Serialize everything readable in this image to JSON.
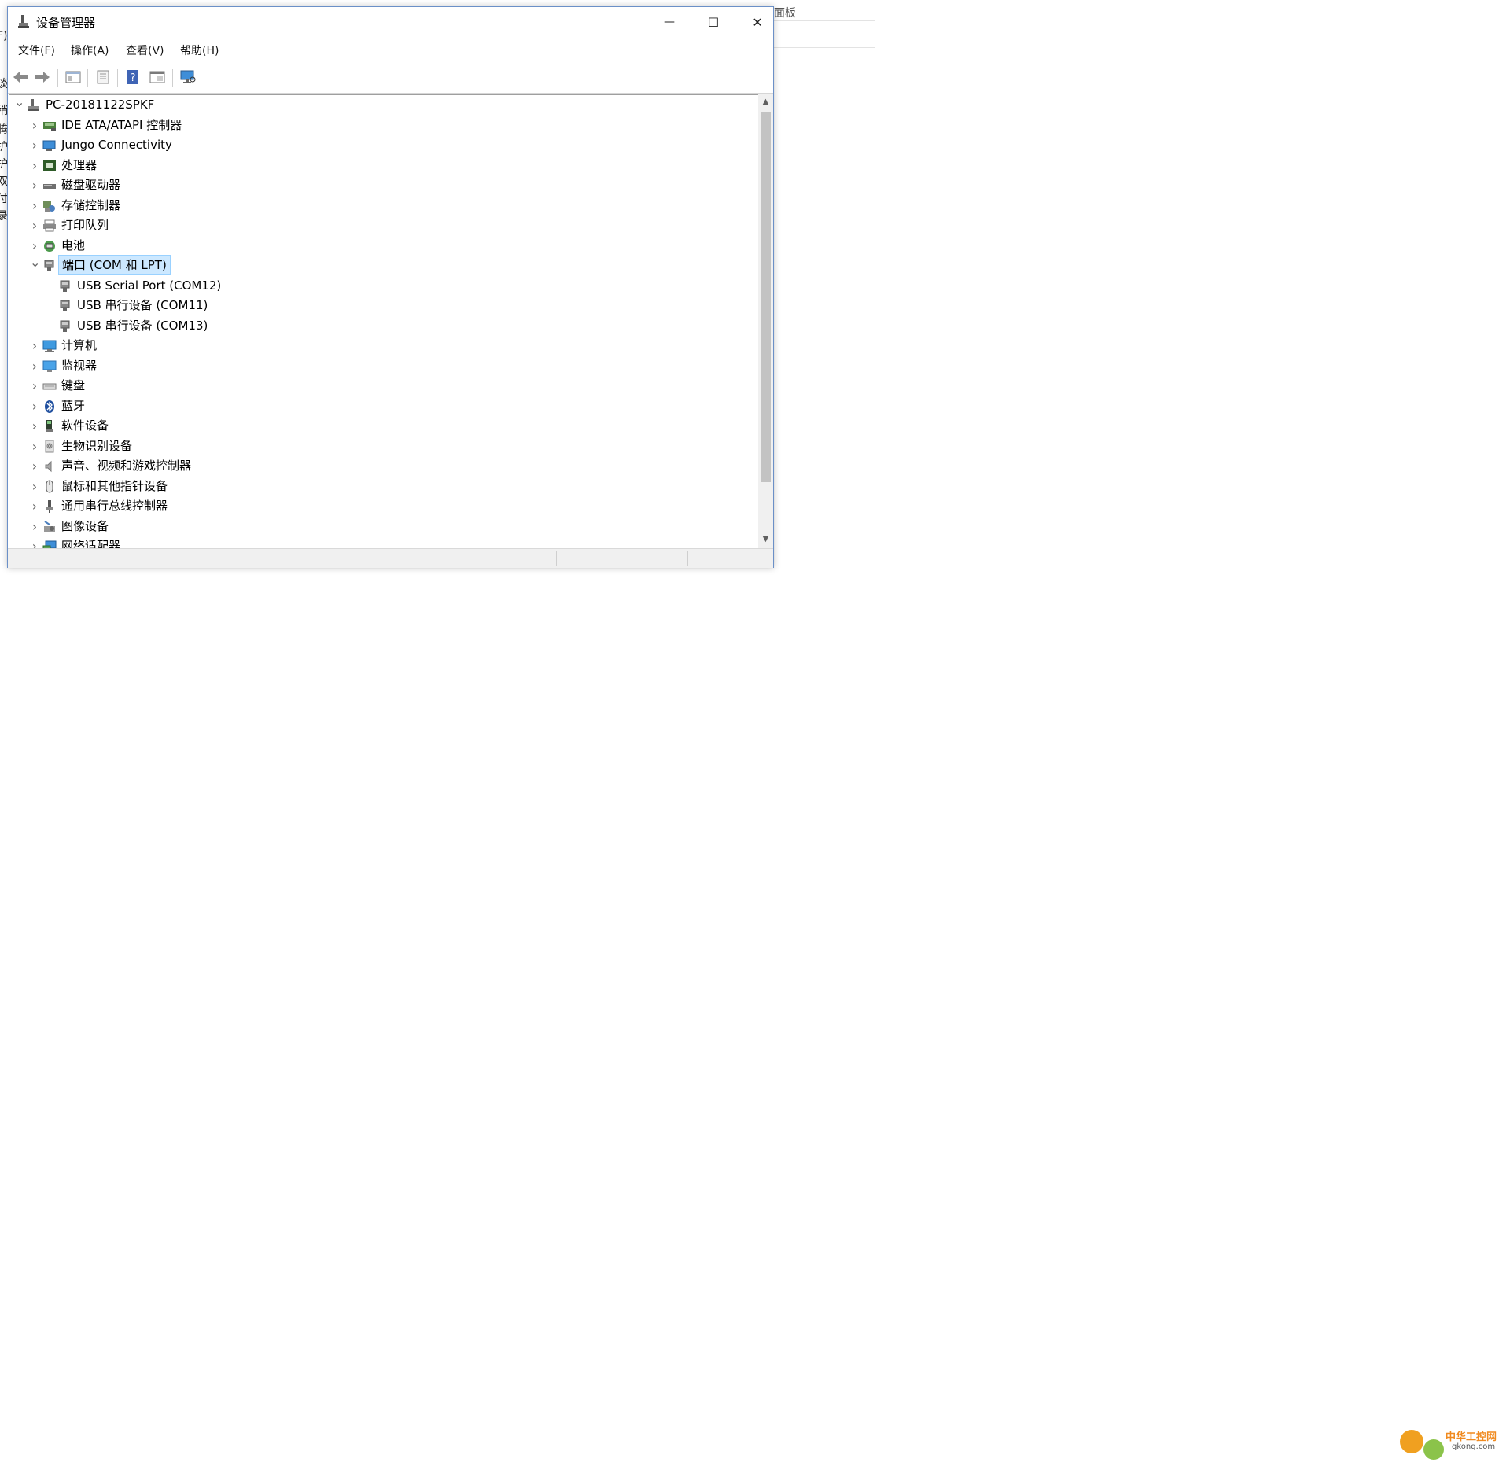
{
  "window": {
    "title": "设备管理器",
    "controls": {
      "minimize": "—",
      "maximize": "☐",
      "close": "✕"
    }
  },
  "menu": [
    {
      "label": "文件(F)"
    },
    {
      "label": "操作(A)"
    },
    {
      "label": "查看(V)"
    },
    {
      "label": "帮助(H)"
    }
  ],
  "toolbar_icons": [
    "back-arrow-icon",
    "forward-arrow-icon",
    "show-hide-tree-icon",
    "properties-icon",
    "help-icon",
    "view-icon",
    "scan-hardware-icon"
  ],
  "tree": {
    "root": "PC-20181122SPKF",
    "categories": [
      {
        "label": "IDE ATA/ATAPI 控制器",
        "icon": "ide-controller-icon",
        "expanded": false
      },
      {
        "label": "Jungo Connectivity",
        "icon": "jungo-icon",
        "expanded": false
      },
      {
        "label": "处理器",
        "icon": "processor-icon",
        "expanded": false
      },
      {
        "label": "磁盘驱动器",
        "icon": "disk-drive-icon",
        "expanded": false
      },
      {
        "label": "存储控制器",
        "icon": "storage-controller-icon",
        "expanded": false
      },
      {
        "label": "打印队列",
        "icon": "print-queue-icon",
        "expanded": false
      },
      {
        "label": "电池",
        "icon": "battery-icon",
        "expanded": false
      },
      {
        "label": "端口 (COM 和 LPT)",
        "icon": "port-icon",
        "expanded": true,
        "selected": true,
        "children": [
          {
            "label": "USB Serial Port (COM12)",
            "icon": "port-icon"
          },
          {
            "label": "USB 串行设备 (COM11)",
            "icon": "port-icon"
          },
          {
            "label": "USB 串行设备 (COM13)",
            "icon": "port-icon"
          }
        ]
      },
      {
        "label": "计算机",
        "icon": "computer-icon",
        "expanded": false
      },
      {
        "label": "监视器",
        "icon": "monitor-icon",
        "expanded": false
      },
      {
        "label": "键盘",
        "icon": "keyboard-icon",
        "expanded": false
      },
      {
        "label": "蓝牙",
        "icon": "bluetooth-icon",
        "expanded": false
      },
      {
        "label": "软件设备",
        "icon": "software-device-icon",
        "expanded": false
      },
      {
        "label": "生物识别设备",
        "icon": "biometric-icon",
        "expanded": false
      },
      {
        "label": "声音、视频和游戏控制器",
        "icon": "sound-icon",
        "expanded": false
      },
      {
        "label": "鼠标和其他指针设备",
        "icon": "mouse-icon",
        "expanded": false
      },
      {
        "label": "通用串行总线控制器",
        "icon": "usb-icon",
        "expanded": false
      },
      {
        "label": "图像设备",
        "icon": "imaging-icon",
        "expanded": false
      },
      {
        "label": "网络适配器",
        "icon": "network-adapter-icon",
        "expanded": false
      }
    ]
  },
  "background": {
    "right_text": "面板",
    "left_glyphs": [
      "F)",
      "谈",
      "稍",
      "腾",
      "护",
      "护",
      "双",
      "付",
      "录"
    ]
  },
  "watermark": {
    "title": "中华工控网",
    "url": "gkong.com"
  },
  "colors": {
    "selection_bg": "#cce8ff",
    "selection_border": "#99d1ff",
    "window_border": "#6b90c8"
  }
}
